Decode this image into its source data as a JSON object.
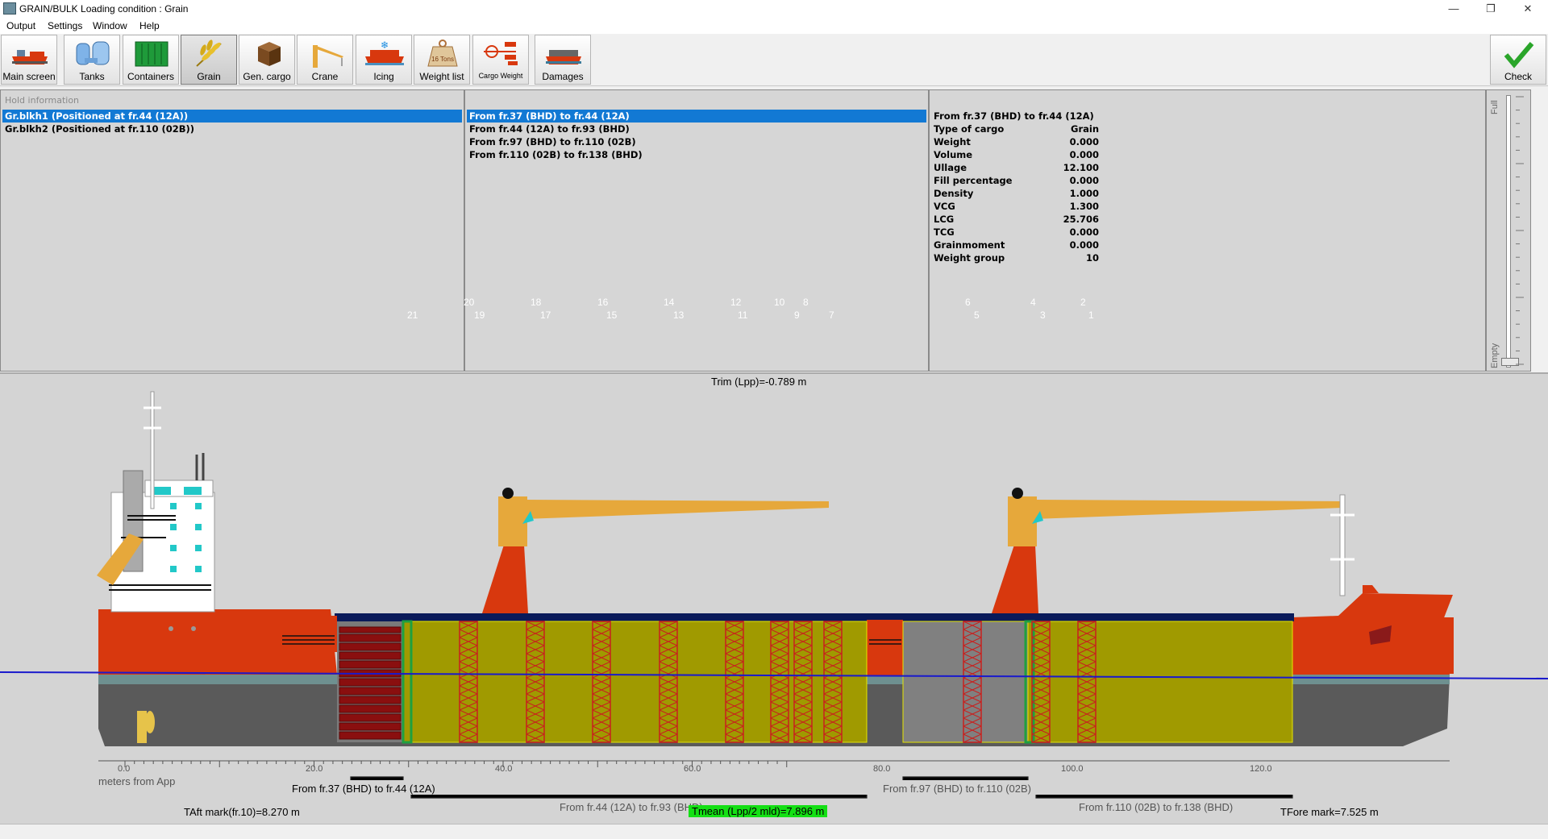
{
  "window": {
    "title": "GRAIN/BULK  Loading condition : Grain",
    "controls": {
      "minimize": "—",
      "restore": "❐",
      "close": "✕"
    }
  },
  "menu": [
    "Output",
    "Settings",
    "Window",
    "Help"
  ],
  "toolbar": {
    "buttons": [
      {
        "label": "Main screen",
        "icon": "ship-icon"
      },
      {
        "label": "Tanks",
        "icon": "tanks-icon"
      },
      {
        "label": "Containers",
        "icon": "containers-icon"
      },
      {
        "label": "Grain",
        "icon": "grain-icon",
        "active": true
      },
      {
        "label": "Gen. cargo",
        "icon": "crate-icon"
      },
      {
        "label": "Crane",
        "icon": "crane-icon"
      },
      {
        "label": "Icing",
        "icon": "icing-icon"
      },
      {
        "label": "Weight list",
        "icon": "weight-icon",
        "badge": "16 Tons"
      },
      {
        "label": "Cargo Weight",
        "icon": "cargo-weight-icon"
      },
      {
        "label": "Damages",
        "icon": "damages-icon"
      }
    ],
    "check_label": "Check"
  },
  "hold_panel": {
    "header": "Hold information",
    "items": [
      "Gr.blkh1 (Positioned at fr.44 (12A))",
      "Gr.blkh2 (Positioned at fr.110 (02B))"
    ],
    "selected": 0
  },
  "compartment_panel": {
    "items": [
      "From fr.37 (BHD) to fr.44 (12A)",
      "From fr.44 (12A) to fr.93 (BHD)",
      "From fr.97 (BHD) to fr.110 (02B)",
      "From fr.110 (02B) to fr.138 (BHD)"
    ],
    "selected": 0
  },
  "details_panel": {
    "title": "From fr.37 (BHD) to fr.44 (12A)",
    "properties": [
      {
        "label": "Type of cargo",
        "value": "Grain"
      },
      {
        "label": "Weight",
        "value": "0.000"
      },
      {
        "label": "Volume",
        "value": "0.000"
      },
      {
        "label": "Ullage",
        "value": "12.100"
      },
      {
        "label": "Fill percentage",
        "value": "0.000"
      },
      {
        "label": "Density",
        "value": "1.000"
      },
      {
        "label": "VCG",
        "value": "1.300"
      },
      {
        "label": "LCG",
        "value": "25.706"
      },
      {
        "label": "TCG",
        "value": "0.000"
      },
      {
        "label": "Grainmoment",
        "value": "0.000"
      },
      {
        "label": "Weight group",
        "value": "10"
      }
    ]
  },
  "gauge": {
    "top_label": "Full",
    "bottom_label": "Empty",
    "fill_fraction": 0.0
  },
  "profile": {
    "trim": "Trim (Lpp)=-0.789 m",
    "axis_ticks": [
      "0.0",
      "20.0",
      "40.0",
      "60.0",
      "80.0",
      "100.0",
      "120.0"
    ],
    "axis_caption": "meters from App",
    "frame_numbers": [
      "21",
      "20",
      "19",
      "18",
      "17",
      "16",
      "15",
      "14",
      "13",
      "12",
      "11",
      "10",
      "9",
      "8",
      "7",
      "6",
      "5",
      "4",
      "3",
      "2",
      "1"
    ],
    "compartment_labels": [
      "From fr.37 (BHD) to fr.44 (12A)",
      "From fr.44 (12A) to fr.93 (BHD)",
      "From fr.97 (BHD) to fr.110 (02B)",
      "From fr.110 (02B) to fr.138 (BHD)"
    ],
    "taft": "TAft mark(fr.10)=8.270 m",
    "tmean": "Tmean (Lpp/2 mld)=7.896 m",
    "tfore": "TFore mark=7.525 m"
  },
  "colors": {
    "hull_red": "#d8380e",
    "hull_grey": "#5a5a5a",
    "grain_hold": "#a09a00",
    "crane": "#e6a83b",
    "selection": "#1279d4",
    "waterline": "#1a1acc",
    "tmean_bg": "#14e014"
  }
}
